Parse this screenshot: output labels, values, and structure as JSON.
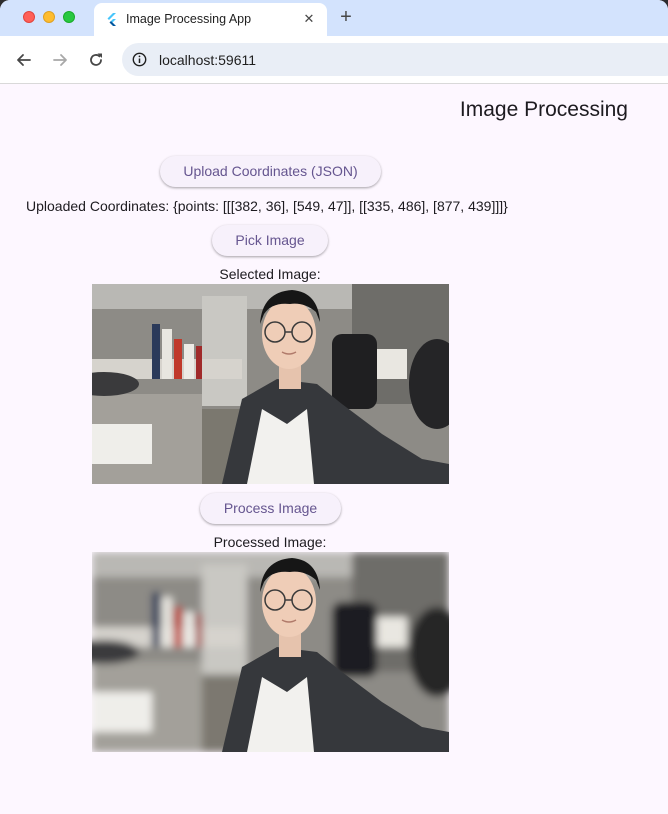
{
  "browser": {
    "tab_title": "Image Processing App",
    "tab_close_label": "✕",
    "new_tab_label": "+",
    "url": "localhost:59611"
  },
  "page": {
    "title": "Image Processing",
    "upload_button_label": "Upload Coordinates (JSON)",
    "uploaded_coordinates_text": "Uploaded Coordinates: {points: [[[382, 36], [549, 47]], [[335, 486], [877, 439]]]}",
    "pick_image_button_label": "Pick Image",
    "selected_image_label": "Selected Image:",
    "process_image_button_label": "Process Image",
    "processed_image_label": "Processed Image:"
  },
  "colors": {
    "page_background": "#fdf7ff",
    "button_background": "#f7f1fb",
    "button_text": "#65558f",
    "tab_strip": "#d3e3fd"
  },
  "icons": [
    "flutter-favicon-icon",
    "close-icon",
    "plus-icon",
    "back-arrow-icon",
    "forward-arrow-icon",
    "reload-icon",
    "info-icon"
  ]
}
